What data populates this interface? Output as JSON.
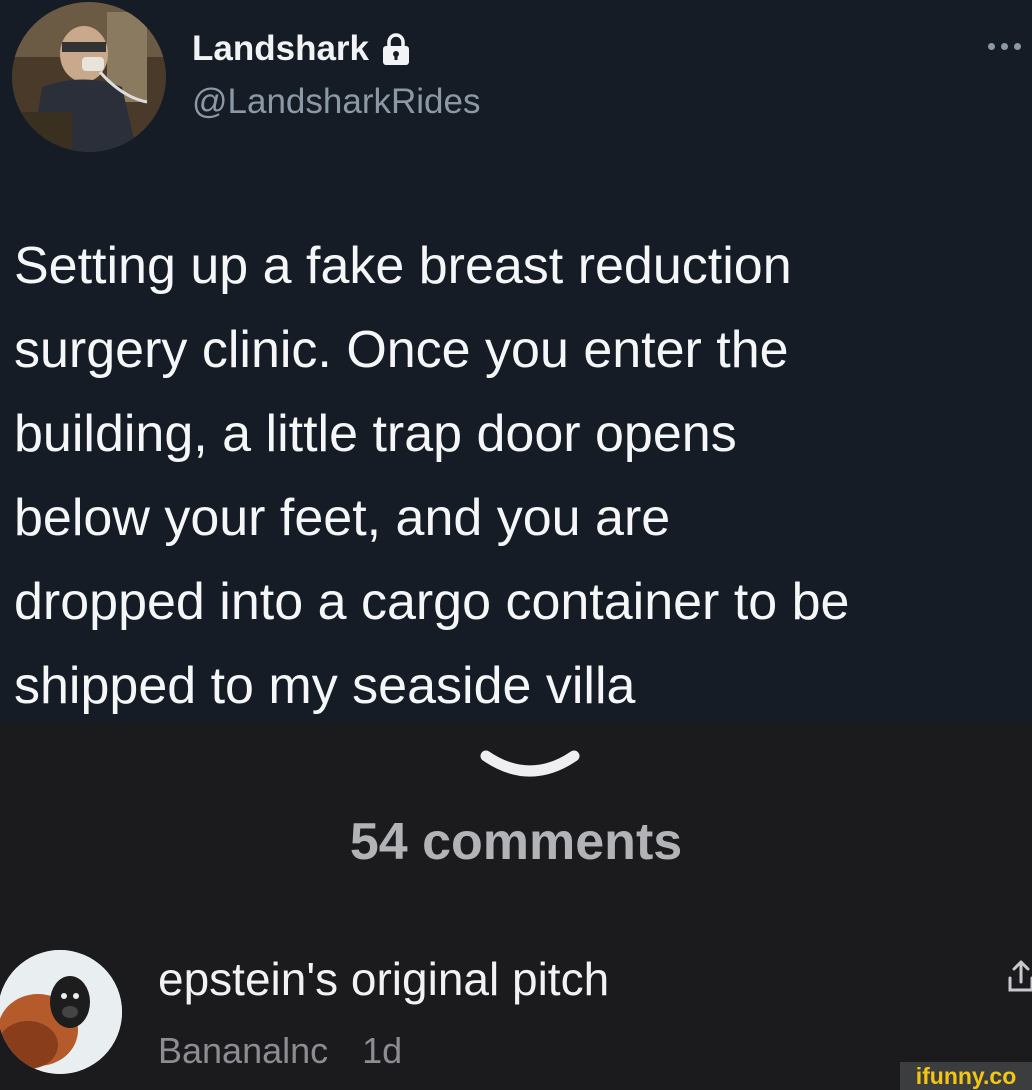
{
  "tweet": {
    "display_name": "Landshark",
    "handle": "@LandsharkRides",
    "icons": {
      "lock": "lock-icon",
      "more": "more-options-icon"
    },
    "text": "Setting up a fake breast reduction\nsurgery clinic. Once you enter the\nbuilding, a little trap door opens\nbelow your feet, and you are\ndropped into a cargo container to be\nshipped to my seaside villa"
  },
  "expand_icon": "chevron-down-icon",
  "comments_header": "54 comments",
  "comment": {
    "text": "epstein's original pitch",
    "author": "Bananalnc",
    "time": "1d",
    "share_icon": "share-icon"
  },
  "watermark": "ifunny.co",
  "colors": {
    "tweet_bg": "#151c25",
    "page_bg": "#1b1b1e",
    "watermark": "#f4c614"
  }
}
